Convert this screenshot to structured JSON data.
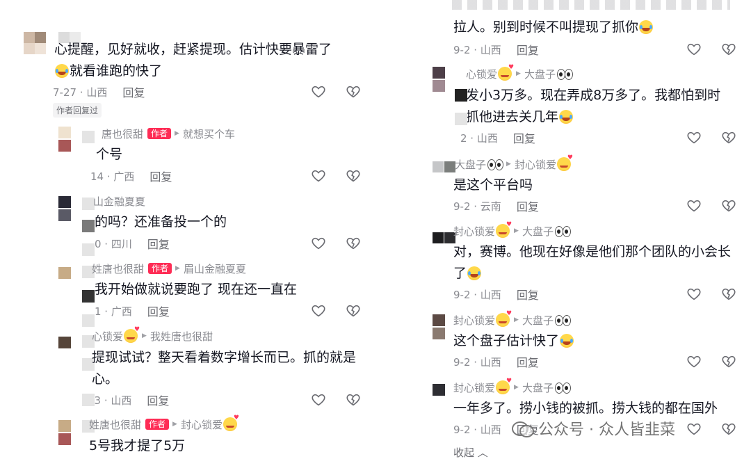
{
  "left": {
    "comments": [
      {
        "name": "",
        "text_lines": [
          "心提醒，见好就收，赶紧提现。估计快要暴雷了",
          "就看谁跑的快了"
        ],
        "date": "7-27 · 山西",
        "reply": "回复",
        "author_replied": "作者回复过"
      },
      {
        "name": "唐也很甜",
        "badge": "作者",
        "target": "就想买个车",
        "text_lines": [
          "个号"
        ],
        "date": "14 · 广西",
        "reply": "回复"
      },
      {
        "name": "山金融夏夏",
        "text_lines": [
          "的吗？还准备投一个的"
        ],
        "date": "0 · 四川",
        "reply": "回复"
      },
      {
        "name": "姓唐也很甜",
        "badge": "作者",
        "target": "眉山金融夏夏",
        "text_lines": [
          "我开始做就说要跑了 现在还一直在"
        ],
        "date": "1 · 广西",
        "reply": "回复"
      },
      {
        "name": "心锁爱",
        "target": "我姓唐也很甜",
        "text_lines": [
          "提现试试？整天看着数字增长而已。抓的就是",
          "心。"
        ],
        "date": "13 · 山西",
        "reply": "回复"
      },
      {
        "name": "姓唐也很甜",
        "badge": "作者",
        "target": "封心锁爱",
        "text_lines": [
          "5号我才提了5万"
        ]
      }
    ]
  },
  "right": {
    "comments": [
      {
        "text_lines": [
          "拉人。别到时候不叫提现了抓你"
        ],
        "date": "9-2 · 山西",
        "reply": "回复"
      },
      {
        "name": "心锁爱",
        "target": "大盘子",
        "text_lines": [
          "发小3万多。现在弄成8万多了。我都怕到时",
          "抓他进去关几年"
        ],
        "date": "2 · 山西",
        "reply": "回复"
      },
      {
        "name": "大盘子",
        "target": "封心锁爱",
        "text_lines": [
          "是这个平台吗"
        ],
        "date": "9-2 · 云南",
        "reply": "回复"
      },
      {
        "name": "封心锁爱",
        "target": "大盘子",
        "text_lines": [
          "对，赛博。他现在好像是他们那个团队的小会长",
          "了"
        ],
        "date": "9-2 · 山西",
        "reply": "回复"
      },
      {
        "name": "封心锁爱",
        "target": "大盘子",
        "text_lines": [
          "这个盘子估计快了"
        ],
        "date": "9-2 · 山西",
        "reply": "回复"
      },
      {
        "name": "封心锁爱",
        "target": "大盘子",
        "text_lines": [
          "一年多了。捞小钱的被抓。捞大钱的都在国外"
        ],
        "date": "9-2 · 山西",
        "reply": "回复"
      }
    ],
    "collapse": "收起"
  },
  "watermark": "公众号 · 众人皆韭菜",
  "colors": {
    "author_badge": "#fe2c55",
    "meta_text": "#8a8b91",
    "body_text": "#161823"
  },
  "icons": {
    "like": "heart-outline-icon",
    "dislike": "broken-heart-icon",
    "laugh": "tears-of-joy-emoji",
    "love": "smiling-face-with-hearts-emoji",
    "eyes": "eyes-emoji"
  }
}
